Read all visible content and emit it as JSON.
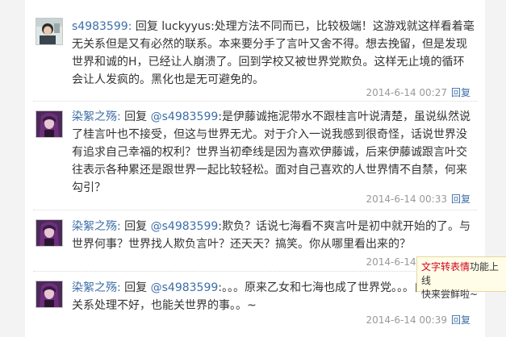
{
  "comments": [
    {
      "user": "s4983599:",
      "reply_word": "回复",
      "target": "luckyyus",
      "text": ":处理方法不同而已，比较极端！这游戏就这样看着毫无关系但是又有必然的联系。本来要分手了言叶又舍不得。想去挽留，但是发现世界和诚的H，已经让人崩溃了。回到学校又被世界党欺负。这样无止境的循环会让人发疯的。黑化也是无可避免的。",
      "time": "2014-6-14 00:27",
      "reply_label": "回复"
    },
    {
      "user": "染絮之殇:",
      "reply_word": "回复",
      "target": "@s4983599",
      "text": ":是伊藤诚拖泥带水不跟桂言叶说清楚，虽说纵然说了桂言叶也不接受，但这与世界无尤。对于介入一说我感到很奇怪，话说世界没有追求自己幸福的权利？世界当初牵线是因为喜欢伊藤诚，后来伊藤诚跟言叶交往表示各种累还是跟世界一起比较轻松。面对自己喜欢的人世界情不自禁，何来勾引？",
      "time": "2014-6-14 00:33",
      "reply_label": "回复"
    },
    {
      "user": "染絮之殇:",
      "reply_word": "回复",
      "target": "@s4983599",
      "text": ":欺负？话说七海看不爽言叶是初中就开始的了。与世界何事？世界找人欺负言叶？还天天？搞笑。你从哪里看出来的？",
      "time": "2014-6-14 00:36",
      "reply_label": "回复"
    },
    {
      "user": "染絮之殇:",
      "reply_word": "回复",
      "target": "@s4983599",
      "text": ":。。。原来乙女和七海也成了世界党。。。自己和同学关系处理不好，也能关世界的事。。~",
      "time": "2014-6-14 00:39",
      "reply_label": "回复"
    }
  ],
  "tooltip": {
    "highlight": "文字转表情",
    "rest": "功能上线",
    "line2": "快来尝鲜啦~"
  }
}
